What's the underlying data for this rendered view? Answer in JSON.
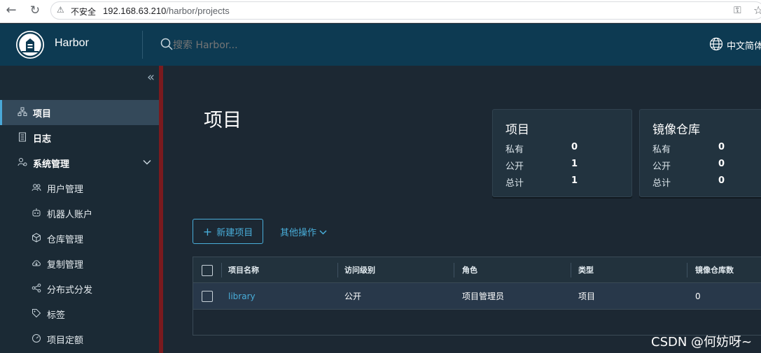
{
  "browser": {
    "security_label": "不安全",
    "url_host": "192.168.63.210",
    "url_path": "/harbor/projects"
  },
  "header": {
    "brand": "Harbor",
    "search_placeholder": "搜索 Harbor...",
    "language": "中文简体"
  },
  "sidebar": {
    "items": [
      {
        "label": "项目",
        "icon": "project-icon",
        "active": true
      },
      {
        "label": "日志",
        "icon": "log-icon"
      },
      {
        "label": "系统管理",
        "icon": "admin-icon",
        "expanded": true
      },
      {
        "label": "用户管理",
        "icon": "users-icon"
      },
      {
        "label": "机器人账户",
        "icon": "robot-icon"
      },
      {
        "label": "仓库管理",
        "icon": "registry-icon"
      },
      {
        "label": "复制管理",
        "icon": "replication-icon"
      },
      {
        "label": "分布式分发",
        "icon": "distribution-icon"
      },
      {
        "label": "标签",
        "icon": "tag-icon"
      },
      {
        "label": "项目定额",
        "icon": "quota-icon"
      }
    ]
  },
  "main": {
    "title": "项目",
    "cards": [
      {
        "title": "项目",
        "rows": [
          {
            "label": "私有",
            "value": "0"
          },
          {
            "label": "公开",
            "value": "1"
          },
          {
            "label": "总计",
            "value": "1"
          }
        ]
      },
      {
        "title": "镜像仓库",
        "rows": [
          {
            "label": "私有",
            "value": "0"
          },
          {
            "label": "公开",
            "value": "0"
          },
          {
            "label": "总计",
            "value": "0"
          }
        ]
      }
    ],
    "new_project_label": "新建项目",
    "other_actions_label": "其他操作",
    "table": {
      "columns": [
        "项目名称",
        "访问级别",
        "角色",
        "类型",
        "镜像仓库数"
      ],
      "rows": [
        {
          "name": "library",
          "access": "公开",
          "role": "项目管理员",
          "type": "项目",
          "repo_count": "0"
        }
      ]
    }
  },
  "watermark": "CSDN @何妨呀~",
  "colors": {
    "header_bg": "#0d3a52",
    "sidebar_bg": "#1b2a35",
    "main_bg": "#1c2833",
    "accent": "#49aeda",
    "sidebar_edge": "#7a1a1e"
  }
}
